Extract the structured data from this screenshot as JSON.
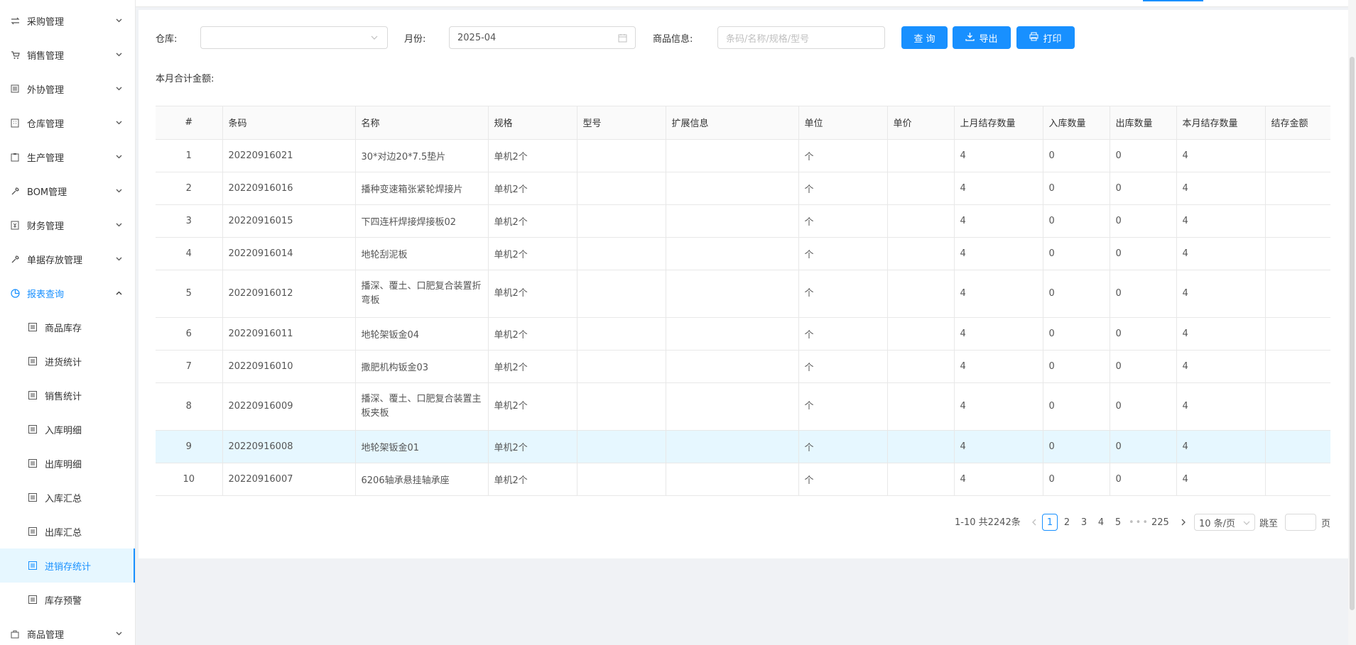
{
  "sidebar": {
    "menus": [
      {
        "label": "采购管理",
        "icon": "swap-icon"
      },
      {
        "label": "销售管理",
        "icon": "cart-icon"
      },
      {
        "label": "外协管理",
        "icon": "doc-icon"
      },
      {
        "label": "仓库管理",
        "icon": "building-icon"
      },
      {
        "label": "生产管理",
        "icon": "clipboard-icon"
      },
      {
        "label": "BOM管理",
        "icon": "wrench-icon"
      },
      {
        "label": "财务管理",
        "icon": "money-icon"
      },
      {
        "label": "单据存放管理",
        "icon": "wrench-icon"
      },
      {
        "label": "报表查询",
        "icon": "pie-chart-icon"
      }
    ],
    "submenus": [
      "商品库存",
      "进货统计",
      "销售统计",
      "入库明细",
      "出库明细",
      "入库汇总",
      "出库汇总",
      "进销存统计",
      "库存预警"
    ],
    "bottom_menu": {
      "label": "商品管理",
      "icon": "bag-icon"
    },
    "accent": "#1890ff"
  },
  "filters": {
    "warehouse_label": "仓库:",
    "warehouse_value": "",
    "month_label": "月份:",
    "month_value": "2025-04",
    "goods_label": "商品信息:",
    "goods_placeholder": "条码/名称/规格/型号"
  },
  "buttons": {
    "query": "查 询",
    "export": "导出",
    "print": "打印"
  },
  "summary_label": "本月合计金额:",
  "table": {
    "headers": [
      "#",
      "条码",
      "名称",
      "规格",
      "型号",
      "扩展信息",
      "单位",
      "单价",
      "上月结存数量",
      "入库数量",
      "出库数量",
      "本月结存数量",
      "结存金额"
    ],
    "rows": [
      [
        "1",
        "20220916021",
        "30*对边20*7.5垫片",
        "单机2个",
        "",
        "",
        "个",
        "",
        "4",
        "0",
        "0",
        "4",
        ""
      ],
      [
        "2",
        "20220916016",
        "播种变速箱张紧轮焊接片",
        "单机2个",
        "",
        "",
        "个",
        "",
        "4",
        "0",
        "0",
        "4",
        ""
      ],
      [
        "3",
        "20220916015",
        "下四连杆焊接焊接板02",
        "单机2个",
        "",
        "",
        "个",
        "",
        "4",
        "0",
        "0",
        "4",
        ""
      ],
      [
        "4",
        "20220916014",
        "地轮刮泥板",
        "单机2个",
        "",
        "",
        "个",
        "",
        "4",
        "0",
        "0",
        "4",
        ""
      ],
      [
        "5",
        "20220916012",
        "播深、覆土、口肥复合装置折弯板",
        "单机2个",
        "",
        "",
        "个",
        "",
        "4",
        "0",
        "0",
        "4",
        ""
      ],
      [
        "6",
        "20220916011",
        "地轮架钣金04",
        "单机2个",
        "",
        "",
        "个",
        "",
        "4",
        "0",
        "0",
        "4",
        ""
      ],
      [
        "7",
        "20220916010",
        "撒肥机构钣金03",
        "单机2个",
        "",
        "",
        "个",
        "",
        "4",
        "0",
        "0",
        "4",
        ""
      ],
      [
        "8",
        "20220916009",
        "播深、覆土、口肥复合装置主板夹板",
        "单机2个",
        "",
        "",
        "个",
        "",
        "4",
        "0",
        "0",
        "4",
        ""
      ],
      [
        "9",
        "20220916008",
        "地轮架钣金01",
        "单机2个",
        "",
        "",
        "个",
        "",
        "4",
        "0",
        "0",
        "4",
        ""
      ],
      [
        "10",
        "20220916007",
        "6206轴承悬挂轴承座",
        "单机2个",
        "",
        "",
        "个",
        "",
        "4",
        "0",
        "0",
        "4",
        ""
      ]
    ],
    "highlighted_row": 9
  },
  "pagination": {
    "total_text": "1-10 共2242条",
    "pages": [
      "1",
      "2",
      "3",
      "4",
      "5"
    ],
    "ellipsis": "•••",
    "last_page": "225",
    "current": "1",
    "page_size": "10 条/页",
    "jump_label": "跳至",
    "page_suffix": "页"
  }
}
